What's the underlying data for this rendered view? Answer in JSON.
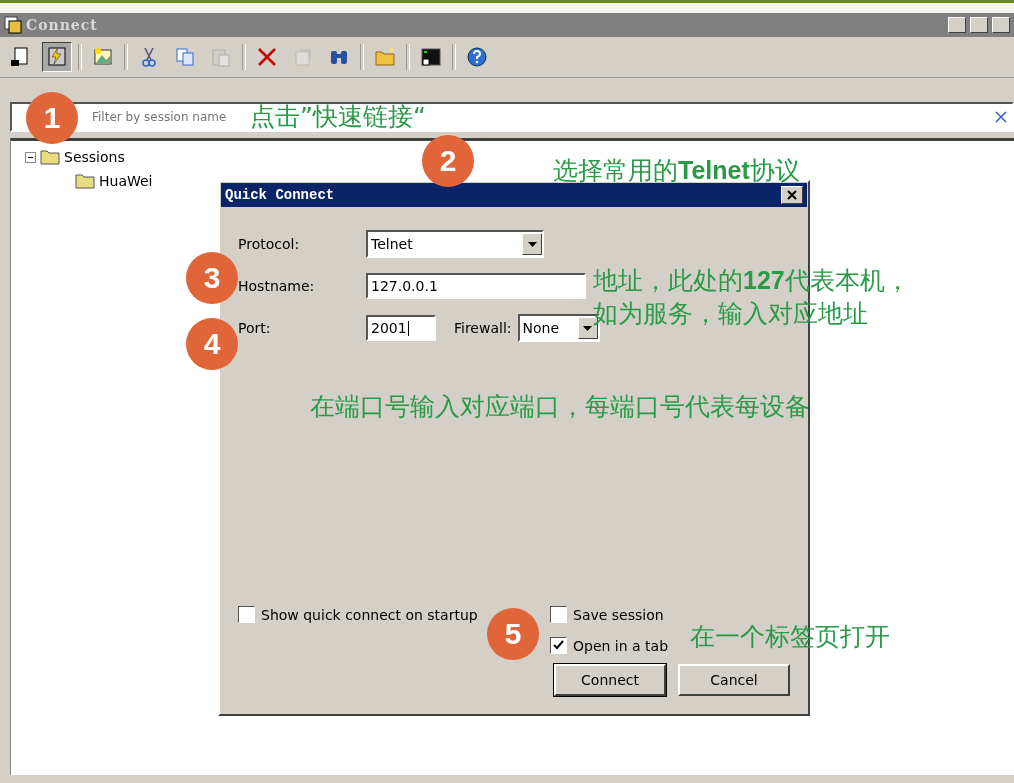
{
  "window": {
    "title": "Connect"
  },
  "toolbar": [
    {
      "kind": "connect",
      "selected": false,
      "disabled": false
    },
    {
      "kind": "quick-connect",
      "selected": true,
      "disabled": false
    },
    {
      "kind": "separator"
    },
    {
      "kind": "tab",
      "selected": false,
      "disabled": false
    },
    {
      "kind": "separator"
    },
    {
      "kind": "cut",
      "selected": false,
      "disabled": false
    },
    {
      "kind": "copy",
      "selected": false,
      "disabled": false
    },
    {
      "kind": "paste",
      "selected": false,
      "disabled": true
    },
    {
      "kind": "separator"
    },
    {
      "kind": "delete",
      "selected": false,
      "disabled": false
    },
    {
      "kind": "properties",
      "selected": false,
      "disabled": true
    },
    {
      "kind": "find",
      "selected": false,
      "disabled": false
    },
    {
      "kind": "separator"
    },
    {
      "kind": "folder",
      "selected": false,
      "disabled": false
    },
    {
      "kind": "separator"
    },
    {
      "kind": "terminal",
      "selected": false,
      "disabled": false
    },
    {
      "kind": "separator"
    },
    {
      "kind": "help",
      "selected": false,
      "disabled": false
    }
  ],
  "filter": {
    "placeholder": "Filter by session name"
  },
  "tree": [
    {
      "label": "Sessions",
      "expanded": true,
      "children": [
        {
          "label": "HuaWei"
        }
      ]
    }
  ],
  "dialog": {
    "title": "Quick Connect",
    "protocol": {
      "label": "Protocol:",
      "value": "Telnet"
    },
    "hostname": {
      "label": "Hostname:",
      "value": "127.0.0.1"
    },
    "port": {
      "label": "Port:",
      "value": "2001"
    },
    "firewall": {
      "label": "Firewall:",
      "value": "None"
    },
    "checkboxes": [
      {
        "label": "Show quick connect on startup",
        "checked": false
      },
      {
        "label": "Save session",
        "checked": false
      },
      {
        "label": "Open in a tab",
        "checked": true
      }
    ],
    "buttons": [
      {
        "label": "Connect",
        "default": true
      },
      {
        "label": "Cancel",
        "default": false
      }
    ]
  },
  "annotations": [
    {
      "number": "1",
      "lines": [
        "点击”快速链接“"
      ]
    },
    {
      "number": "2",
      "lines": [
        "选择常用的**Telnet**协议"
      ]
    },
    {
      "number": "3",
      "lines": [
        "地址，此处的**127**代表本机，",
        "如为服务，输入对应地址"
      ]
    },
    {
      "number": "4",
      "lines": [
        "在端口号输入对应端口，每端口号代表每设备"
      ]
    },
    {
      "number": "5",
      "lines": [
        "在一个标签页打开"
      ]
    }
  ]
}
